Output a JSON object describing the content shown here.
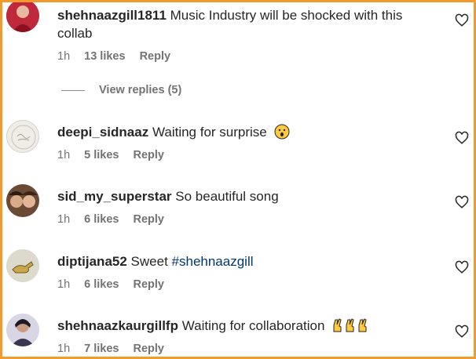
{
  "comments": [
    {
      "username": "shehnaazgill1811",
      "text": "Music Industry will be shocked with this collab",
      "time": "1h",
      "likes": "13 likes",
      "reply": "Reply",
      "avatar_color": "#c0283b"
    },
    {
      "username": "deepi_sidnaaz",
      "text": "Waiting for surprise",
      "emoji": "surprised-face-emoji",
      "time": "1h",
      "likes": "5 likes",
      "reply": "Reply",
      "avatar_color": "#e9e6e0"
    },
    {
      "username": "sid_my_superstar",
      "text": "So beautiful song",
      "time": "1h",
      "likes": "6 likes",
      "reply": "Reply",
      "avatar_color": "#8b5a3c"
    },
    {
      "username": "diptijana52",
      "text": "Sweet",
      "hashtag": "#shehnaazgill",
      "time": "1h",
      "likes": "6 likes",
      "reply": "Reply",
      "avatar_color": "#d9d7c7"
    },
    {
      "username": "shehnaazkaurgillfp",
      "text": "Waiting for collaboration",
      "emoji": "crossed-fingers-emoji x3",
      "time": "1h",
      "likes": "7 likes",
      "reply": "Reply",
      "avatar_color": "#3a3550"
    }
  ],
  "view_replies": "View replies (5)",
  "colors": {
    "frame_border": "#f39a2e",
    "text": "#262626",
    "meta": "#737373",
    "hashtag": "#00376b"
  }
}
